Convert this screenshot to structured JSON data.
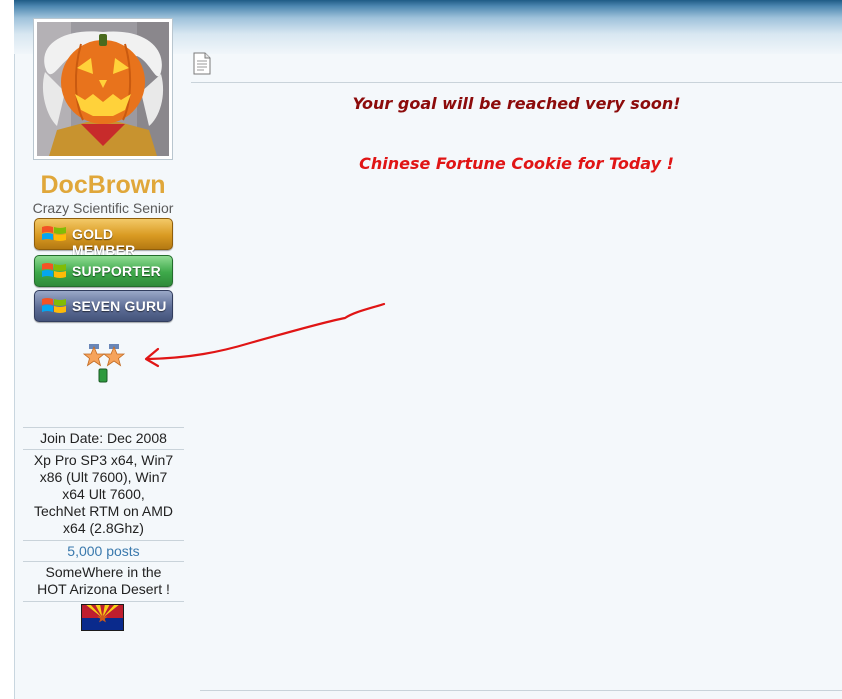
{
  "user": {
    "username": "DocBrown",
    "title": "Crazy Scientific Senior",
    "badges": [
      "GOLD MEMBER",
      "SUPPORTER",
      "SEVEN GURU"
    ],
    "join_date": "Join Date: Dec 2008",
    "system_lines": [
      "Xp Pro SP3 x64, Win7",
      "x86 (Ult 7600), Win7",
      "x64 Ult 7600,",
      "TechNet RTM on AMD",
      "x64 (2.8Ghz)"
    ],
    "posts": "5,000 posts",
    "location_lines": [
      "SomeWhere in the",
      "HOT Arizona Desert !"
    ]
  },
  "post": {
    "line1": "Your goal will be reached very soon!",
    "line2": "Chinese Fortune Cookie for Today !"
  },
  "colors": {
    "username": "#e0a73a",
    "post_line1": "#8c0b0b",
    "post_line2": "#e01515",
    "annotation_arrow": "#e01515"
  },
  "icons": {
    "post_icon": "document-icon",
    "award": "award-stars-icon",
    "location_flag": "arizona-flag-icon"
  }
}
